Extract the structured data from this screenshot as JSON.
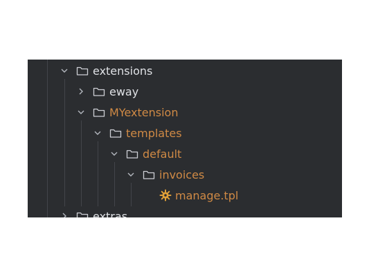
{
  "tree": {
    "items": [
      {
        "label": "extensions",
        "state": "expanded",
        "type": "folder",
        "color": "#dfe1e5"
      },
      {
        "label": "eway",
        "state": "collapsed",
        "type": "folder",
        "color": "#dfe1e5"
      },
      {
        "label": "MYextension",
        "state": "expanded",
        "type": "folder",
        "color": "#d08a45"
      },
      {
        "label": "templates",
        "state": "expanded",
        "type": "folder",
        "color": "#d08a45"
      },
      {
        "label": "default",
        "state": "expanded",
        "type": "folder",
        "color": "#d08a45"
      },
      {
        "label": "invoices",
        "state": "expanded",
        "type": "folder",
        "color": "#d08a45"
      },
      {
        "label": "manage.tpl",
        "state": "file",
        "type": "file",
        "icon": "gear-file-icon",
        "color": "#d08a45"
      },
      {
        "label": "extras",
        "state": "collapsed",
        "type": "folder",
        "color": "#dfe1e5"
      }
    ]
  },
  "colors": {
    "panel_bg": "#2b2d30",
    "text": "#dfe1e5",
    "modified": "#d08a45",
    "guide": "#43454a"
  }
}
